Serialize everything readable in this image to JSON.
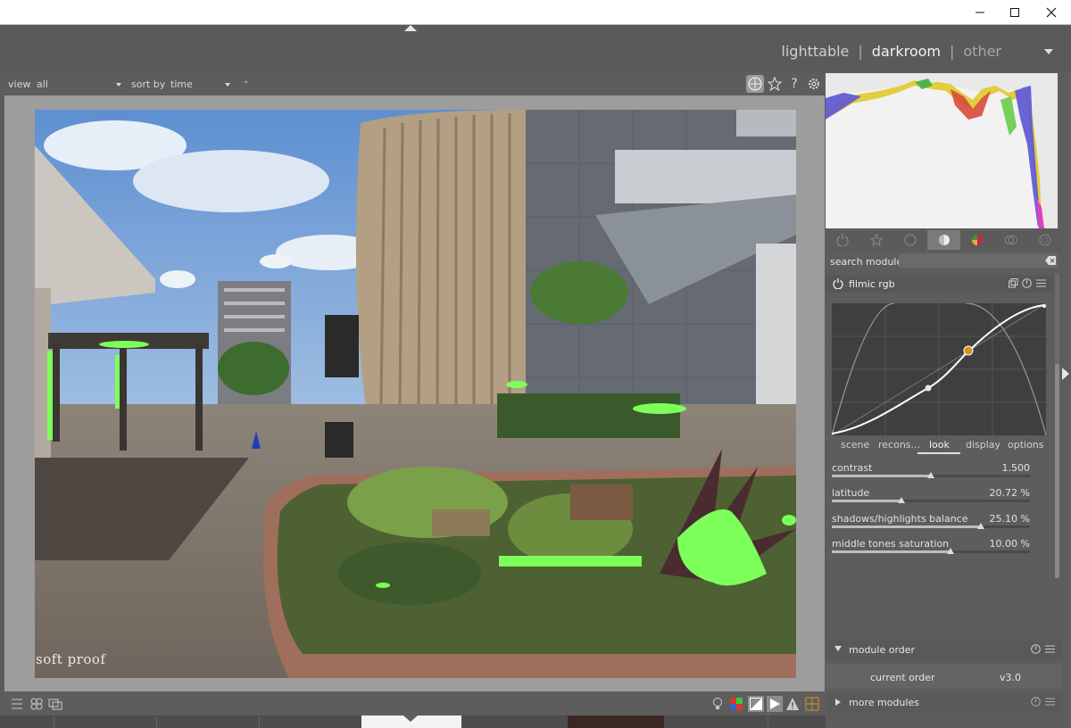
{
  "window": {
    "minimize_icon": "minimize-icon",
    "maximize_icon": "maximize-icon",
    "close_icon": "close-icon"
  },
  "views": {
    "lighttable": "lighttable",
    "separator": "|",
    "darkroom": "darkroom",
    "other": "other"
  },
  "filter": {
    "view_label": "view",
    "view_value": "all",
    "sort_label": "sort by",
    "sort_value": "time",
    "sort_order": "˄"
  },
  "toolbar_right": {
    "help": "?"
  },
  "image": {
    "overlay_label": "soft proof"
  },
  "module_groups": [
    "power-icon",
    "star-icon",
    "circle-icon",
    "tone-icon",
    "color-icon",
    "correct-icon",
    "effect-icon"
  ],
  "search": {
    "label": "search module",
    "value": ""
  },
  "module": {
    "name": "filmic rgb",
    "tabs": [
      "scene",
      "recons...",
      "look",
      "display",
      "options"
    ],
    "active_tab": "look",
    "sliders": [
      {
        "label": "contrast",
        "value": "1.500",
        "fraction": 0.5
      },
      {
        "label": "latitude",
        "value": "20.72 %",
        "fraction": 0.35
      },
      {
        "label": "shadows/highlights balance",
        "value": "25.10 %",
        "fraction": 0.75
      },
      {
        "label": "middle tones saturation",
        "value": "10.00 %",
        "fraction": 0.6
      }
    ]
  },
  "module_order": {
    "title": "module order",
    "label": "current order",
    "value": "v3.0"
  },
  "more_modules": {
    "title": "more modules"
  },
  "colors": {
    "overexposure": "#7dff5a",
    "accent": "#d4921e"
  }
}
